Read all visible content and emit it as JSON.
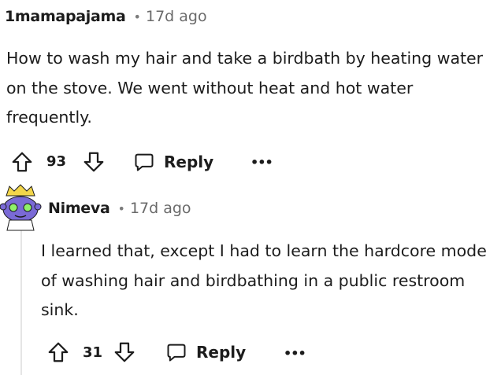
{
  "comments": [
    {
      "author": "1mamapajama",
      "separator": "•",
      "time": "17d ago",
      "body": "How to wash my hair and take a birdbath by heating water on the stove. We went without heat and hot water frequently.",
      "votes": "93",
      "reply_label": "Reply",
      "more_label": "•••",
      "icons": [
        "upvote-icon",
        "downvote-icon",
        "reply-bubble-icon",
        "more-icon"
      ]
    },
    {
      "author": "Nimeva",
      "separator": "•",
      "time": "17d ago",
      "body": "I learned that, except I had to learn the hardcore mode of washing hair and birdbathing in a public restroom sink.",
      "votes": "31",
      "reply_label": "Reply",
      "more_label": "•••",
      "avatar": "snoo-avatar",
      "icons": [
        "upvote-icon",
        "downvote-icon",
        "reply-bubble-icon",
        "more-icon"
      ]
    }
  ],
  "colors": {
    "text": "#1c1c1c",
    "meta": "#6a6a6a",
    "thread_line": "#e5e5e5",
    "avatar_purple": "#7a6ad6"
  }
}
